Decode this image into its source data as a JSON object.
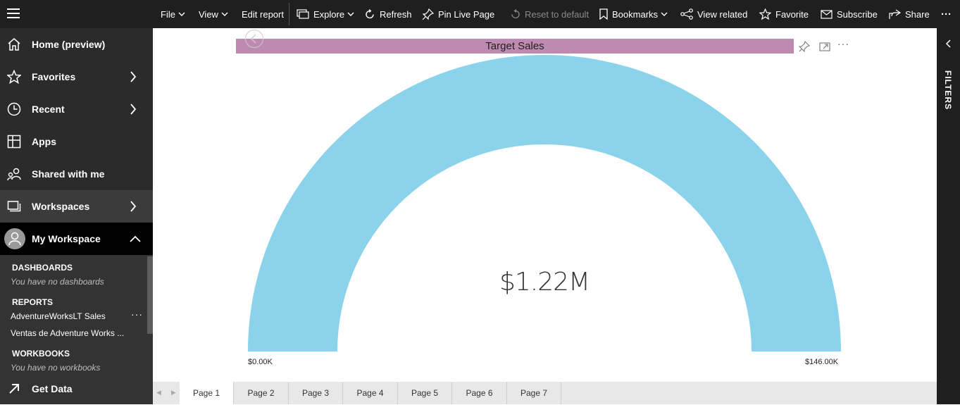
{
  "toolbar": {
    "file": "File",
    "view": "View",
    "edit_report": "Edit report",
    "explore": "Explore",
    "refresh": "Refresh",
    "pin_live_page": "Pin Live Page",
    "reset_to_default": "Reset to default",
    "bookmarks": "Bookmarks",
    "view_related": "View related",
    "favorite": "Favorite",
    "subscribe": "Subscribe",
    "share": "Share",
    "more": "···"
  },
  "sidebar": {
    "home": "Home (preview)",
    "favorites": "Favorites",
    "recent": "Recent",
    "apps": "Apps",
    "shared": "Shared with me",
    "workspaces": "Workspaces",
    "my_workspace": "My Workspace",
    "dashboards_header": "DASHBOARDS",
    "dashboards_empty": "You have no dashboards",
    "reports_header": "REPORTS",
    "reports": [
      "AdventureWorksLT Sales",
      "Ventas de Adventure Works ..."
    ],
    "report_more": "···",
    "workbooks_header": "WORKBOOKS",
    "workbooks_empty": "You have no workbooks",
    "get_data": "Get Data"
  },
  "visual": {
    "title": "Target Sales",
    "value": "$1.22M",
    "min_label": "$0.00K",
    "max_label": "$146.00K",
    "gauge_fill_fraction": 1.0,
    "gauge_color": "#8ad3ea",
    "title_bg": "#be8ab0",
    "more": "···"
  },
  "filters": {
    "label": "FILTERS"
  },
  "pages": [
    "Page 1",
    "Page 2",
    "Page 3",
    "Page 4",
    "Page 5",
    "Page 6",
    "Page 7"
  ],
  "active_page": "Page 1"
}
